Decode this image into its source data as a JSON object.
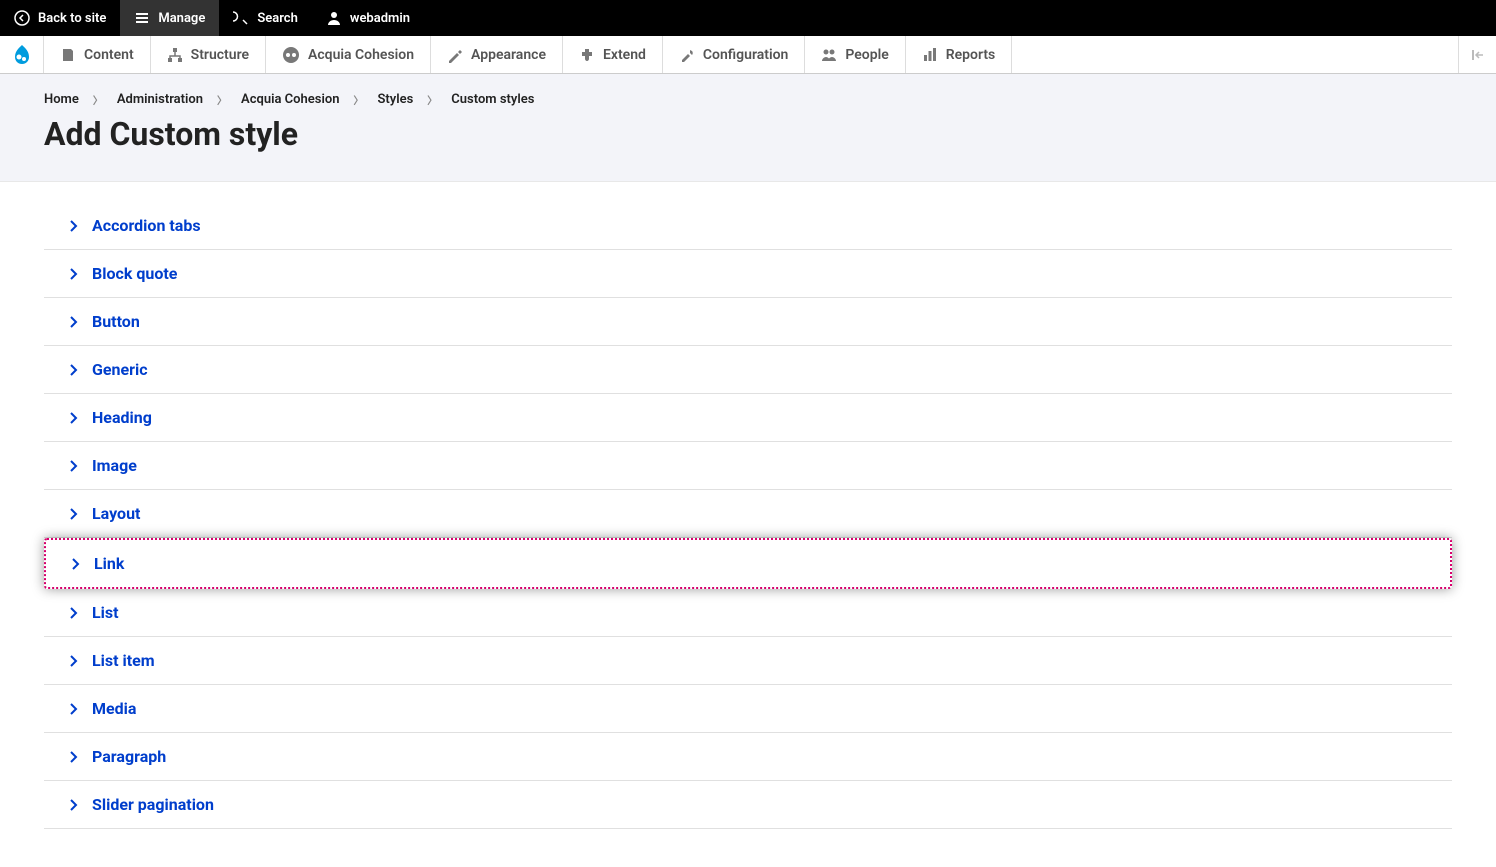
{
  "toolbar_top": {
    "back": "Back to site",
    "manage": "Manage",
    "search": "Search",
    "user": "webadmin"
  },
  "toolbar_second": {
    "items": [
      {
        "label": "Content"
      },
      {
        "label": "Structure"
      },
      {
        "label": "Acquia Cohesion"
      },
      {
        "label": "Appearance"
      },
      {
        "label": "Extend"
      },
      {
        "label": "Configuration"
      },
      {
        "label": "People"
      },
      {
        "label": "Reports"
      }
    ]
  },
  "breadcrumb": {
    "items": [
      "Home",
      "Administration",
      "Acquia Cohesion",
      "Styles",
      "Custom styles"
    ]
  },
  "page_title": "Add Custom style",
  "styles": [
    {
      "label": "Accordion tabs",
      "highlighted": false
    },
    {
      "label": "Block quote",
      "highlighted": false
    },
    {
      "label": "Button",
      "highlighted": false
    },
    {
      "label": "Generic",
      "highlighted": false
    },
    {
      "label": "Heading",
      "highlighted": false
    },
    {
      "label": "Image",
      "highlighted": false
    },
    {
      "label": "Layout",
      "highlighted": false
    },
    {
      "label": "Link",
      "highlighted": true
    },
    {
      "label": "List",
      "highlighted": false
    },
    {
      "label": "List item",
      "highlighted": false
    },
    {
      "label": "Media",
      "highlighted": false
    },
    {
      "label": "Paragraph",
      "highlighted": false
    },
    {
      "label": "Slider pagination",
      "highlighted": false
    }
  ]
}
